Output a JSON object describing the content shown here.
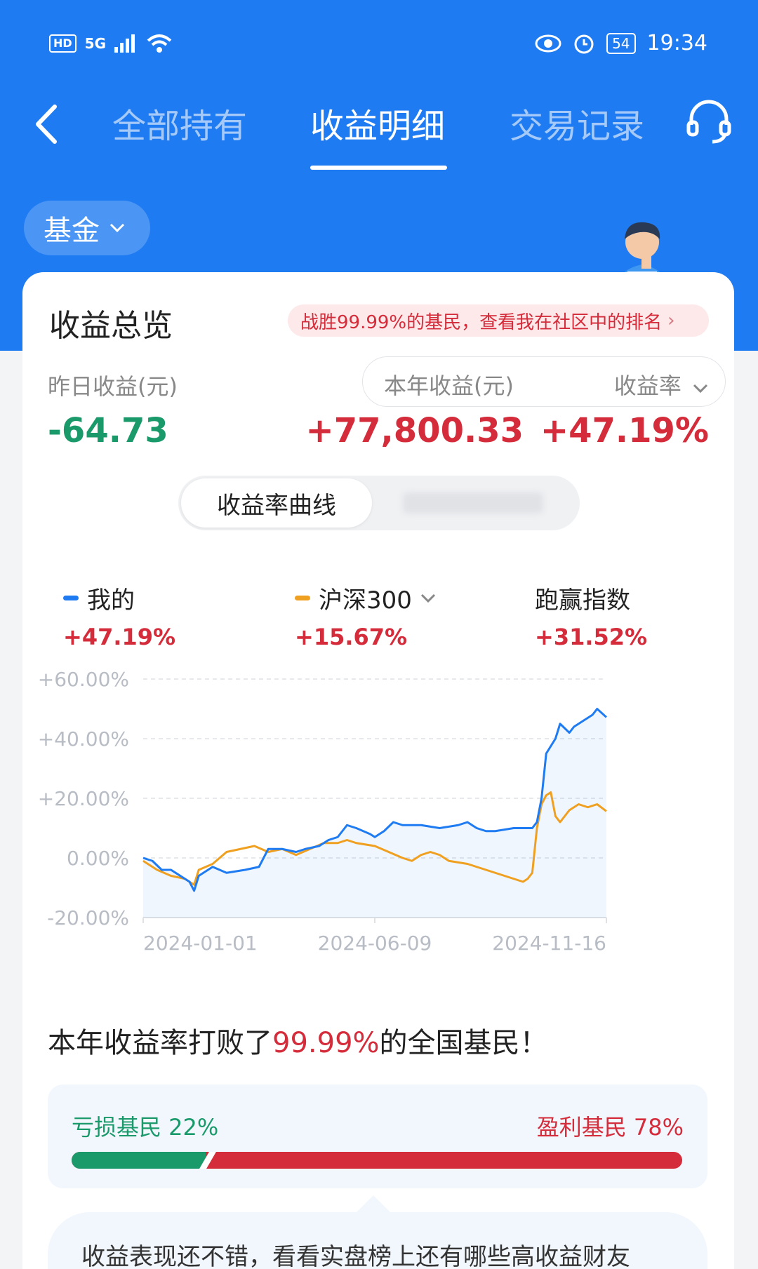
{
  "status_bar": {
    "hd": "HD",
    "network": "5G",
    "battery": "54",
    "time": "19:34"
  },
  "nav": {
    "tabs": [
      "全部持有",
      "收益明细",
      "交易记录"
    ],
    "active_tab": 1
  },
  "filter": {
    "selected": "基金"
  },
  "overview": {
    "title": "收益总览",
    "rank_banner": "战胜99.99%的基民，查看我在社区中的排名",
    "yesterday_label": "昨日收益(元)",
    "yesterday_value": "-64.73",
    "year_label": "本年收益(元)",
    "year_value": "+77,800.33",
    "rate_label": "收益率",
    "rate_value": "+47.19%"
  },
  "segment": {
    "active": "收益率曲线"
  },
  "legend": {
    "mine": {
      "name": "我的",
      "value": "+47.19%"
    },
    "index": {
      "name": "沪深300",
      "value": "+15.67%"
    },
    "beat": {
      "name": "跑赢指数",
      "value": "+31.52%"
    }
  },
  "colors": {
    "brand_blue": "#1f7bf2",
    "gain_red": "#d42c3a",
    "loss_green": "#1a9a6a",
    "index_orange": "#f0a020"
  },
  "chart_data": {
    "type": "line",
    "y_ticks": [
      "+60.00%",
      "+40.00%",
      "+20.00%",
      "0.00%",
      "-20.00%"
    ],
    "x_ticks": [
      "2024-01-01",
      "2024-06-09",
      "2024-11-16"
    ],
    "ylim": [
      -20,
      60
    ],
    "grid": true,
    "series": [
      {
        "name": "我的",
        "color": "#1f7bf2",
        "points": [
          [
            0,
            0
          ],
          [
            0.02,
            -1
          ],
          [
            0.04,
            -4
          ],
          [
            0.06,
            -4
          ],
          [
            0.08,
            -6
          ],
          [
            0.1,
            -8
          ],
          [
            0.11,
            -11
          ],
          [
            0.12,
            -6
          ],
          [
            0.15,
            -3
          ],
          [
            0.18,
            -5
          ],
          [
            0.22,
            -4
          ],
          [
            0.25,
            -3
          ],
          [
            0.27,
            3
          ],
          [
            0.3,
            3
          ],
          [
            0.33,
            2
          ],
          [
            0.35,
            3
          ],
          [
            0.38,
            4
          ],
          [
            0.4,
            6
          ],
          [
            0.42,
            7
          ],
          [
            0.44,
            11
          ],
          [
            0.46,
            10
          ],
          [
            0.49,
            8
          ],
          [
            0.5,
            7
          ],
          [
            0.52,
            9
          ],
          [
            0.54,
            12
          ],
          [
            0.56,
            11
          ],
          [
            0.6,
            11
          ],
          [
            0.64,
            10
          ],
          [
            0.68,
            11
          ],
          [
            0.7,
            12
          ],
          [
            0.72,
            10
          ],
          [
            0.74,
            9
          ],
          [
            0.76,
            9
          ],
          [
            0.8,
            10
          ],
          [
            0.84,
            10
          ],
          [
            0.85,
            12
          ],
          [
            0.86,
            20
          ],
          [
            0.87,
            35
          ],
          [
            0.89,
            40
          ],
          [
            0.9,
            45
          ],
          [
            0.92,
            42
          ],
          [
            0.93,
            44
          ],
          [
            0.95,
            46
          ],
          [
            0.97,
            48
          ],
          [
            0.98,
            50
          ],
          [
            1.0,
            47.19
          ]
        ]
      },
      {
        "name": "沪深300",
        "color": "#f0a020",
        "points": [
          [
            0,
            -1
          ],
          [
            0.03,
            -4
          ],
          [
            0.06,
            -6
          ],
          [
            0.09,
            -7
          ],
          [
            0.11,
            -9
          ],
          [
            0.12,
            -4
          ],
          [
            0.15,
            -2
          ],
          [
            0.18,
            2
          ],
          [
            0.21,
            3
          ],
          [
            0.24,
            4
          ],
          [
            0.27,
            2
          ],
          [
            0.3,
            3
          ],
          [
            0.33,
            1
          ],
          [
            0.36,
            3
          ],
          [
            0.39,
            5
          ],
          [
            0.42,
            5
          ],
          [
            0.44,
            6
          ],
          [
            0.46,
            5
          ],
          [
            0.5,
            4
          ],
          [
            0.53,
            2
          ],
          [
            0.56,
            0
          ],
          [
            0.58,
            -1
          ],
          [
            0.6,
            1
          ],
          [
            0.62,
            2
          ],
          [
            0.64,
            1
          ],
          [
            0.66,
            -1
          ],
          [
            0.7,
            -2
          ],
          [
            0.74,
            -4
          ],
          [
            0.78,
            -6
          ],
          [
            0.8,
            -7
          ],
          [
            0.82,
            -8
          ],
          [
            0.83,
            -7
          ],
          [
            0.84,
            -5
          ],
          [
            0.85,
            10
          ],
          [
            0.86,
            18
          ],
          [
            0.87,
            21
          ],
          [
            0.88,
            22
          ],
          [
            0.89,
            14
          ],
          [
            0.9,
            12
          ],
          [
            0.92,
            16
          ],
          [
            0.94,
            18
          ],
          [
            0.96,
            17
          ],
          [
            0.98,
            18
          ],
          [
            1.0,
            15.67
          ]
        ]
      }
    ]
  },
  "beat_sentence": {
    "prefix": "本年收益率打败了",
    "highlight": "99.99%",
    "suffix": "的全国基民！"
  },
  "distribution": {
    "loss_label": "亏损基民 22%",
    "gain_label": "盈利基民 78%",
    "loss_fraction": 0.22
  },
  "tip_text": "收益表现还不错，看看实盘榜上还有哪些高收益财友"
}
